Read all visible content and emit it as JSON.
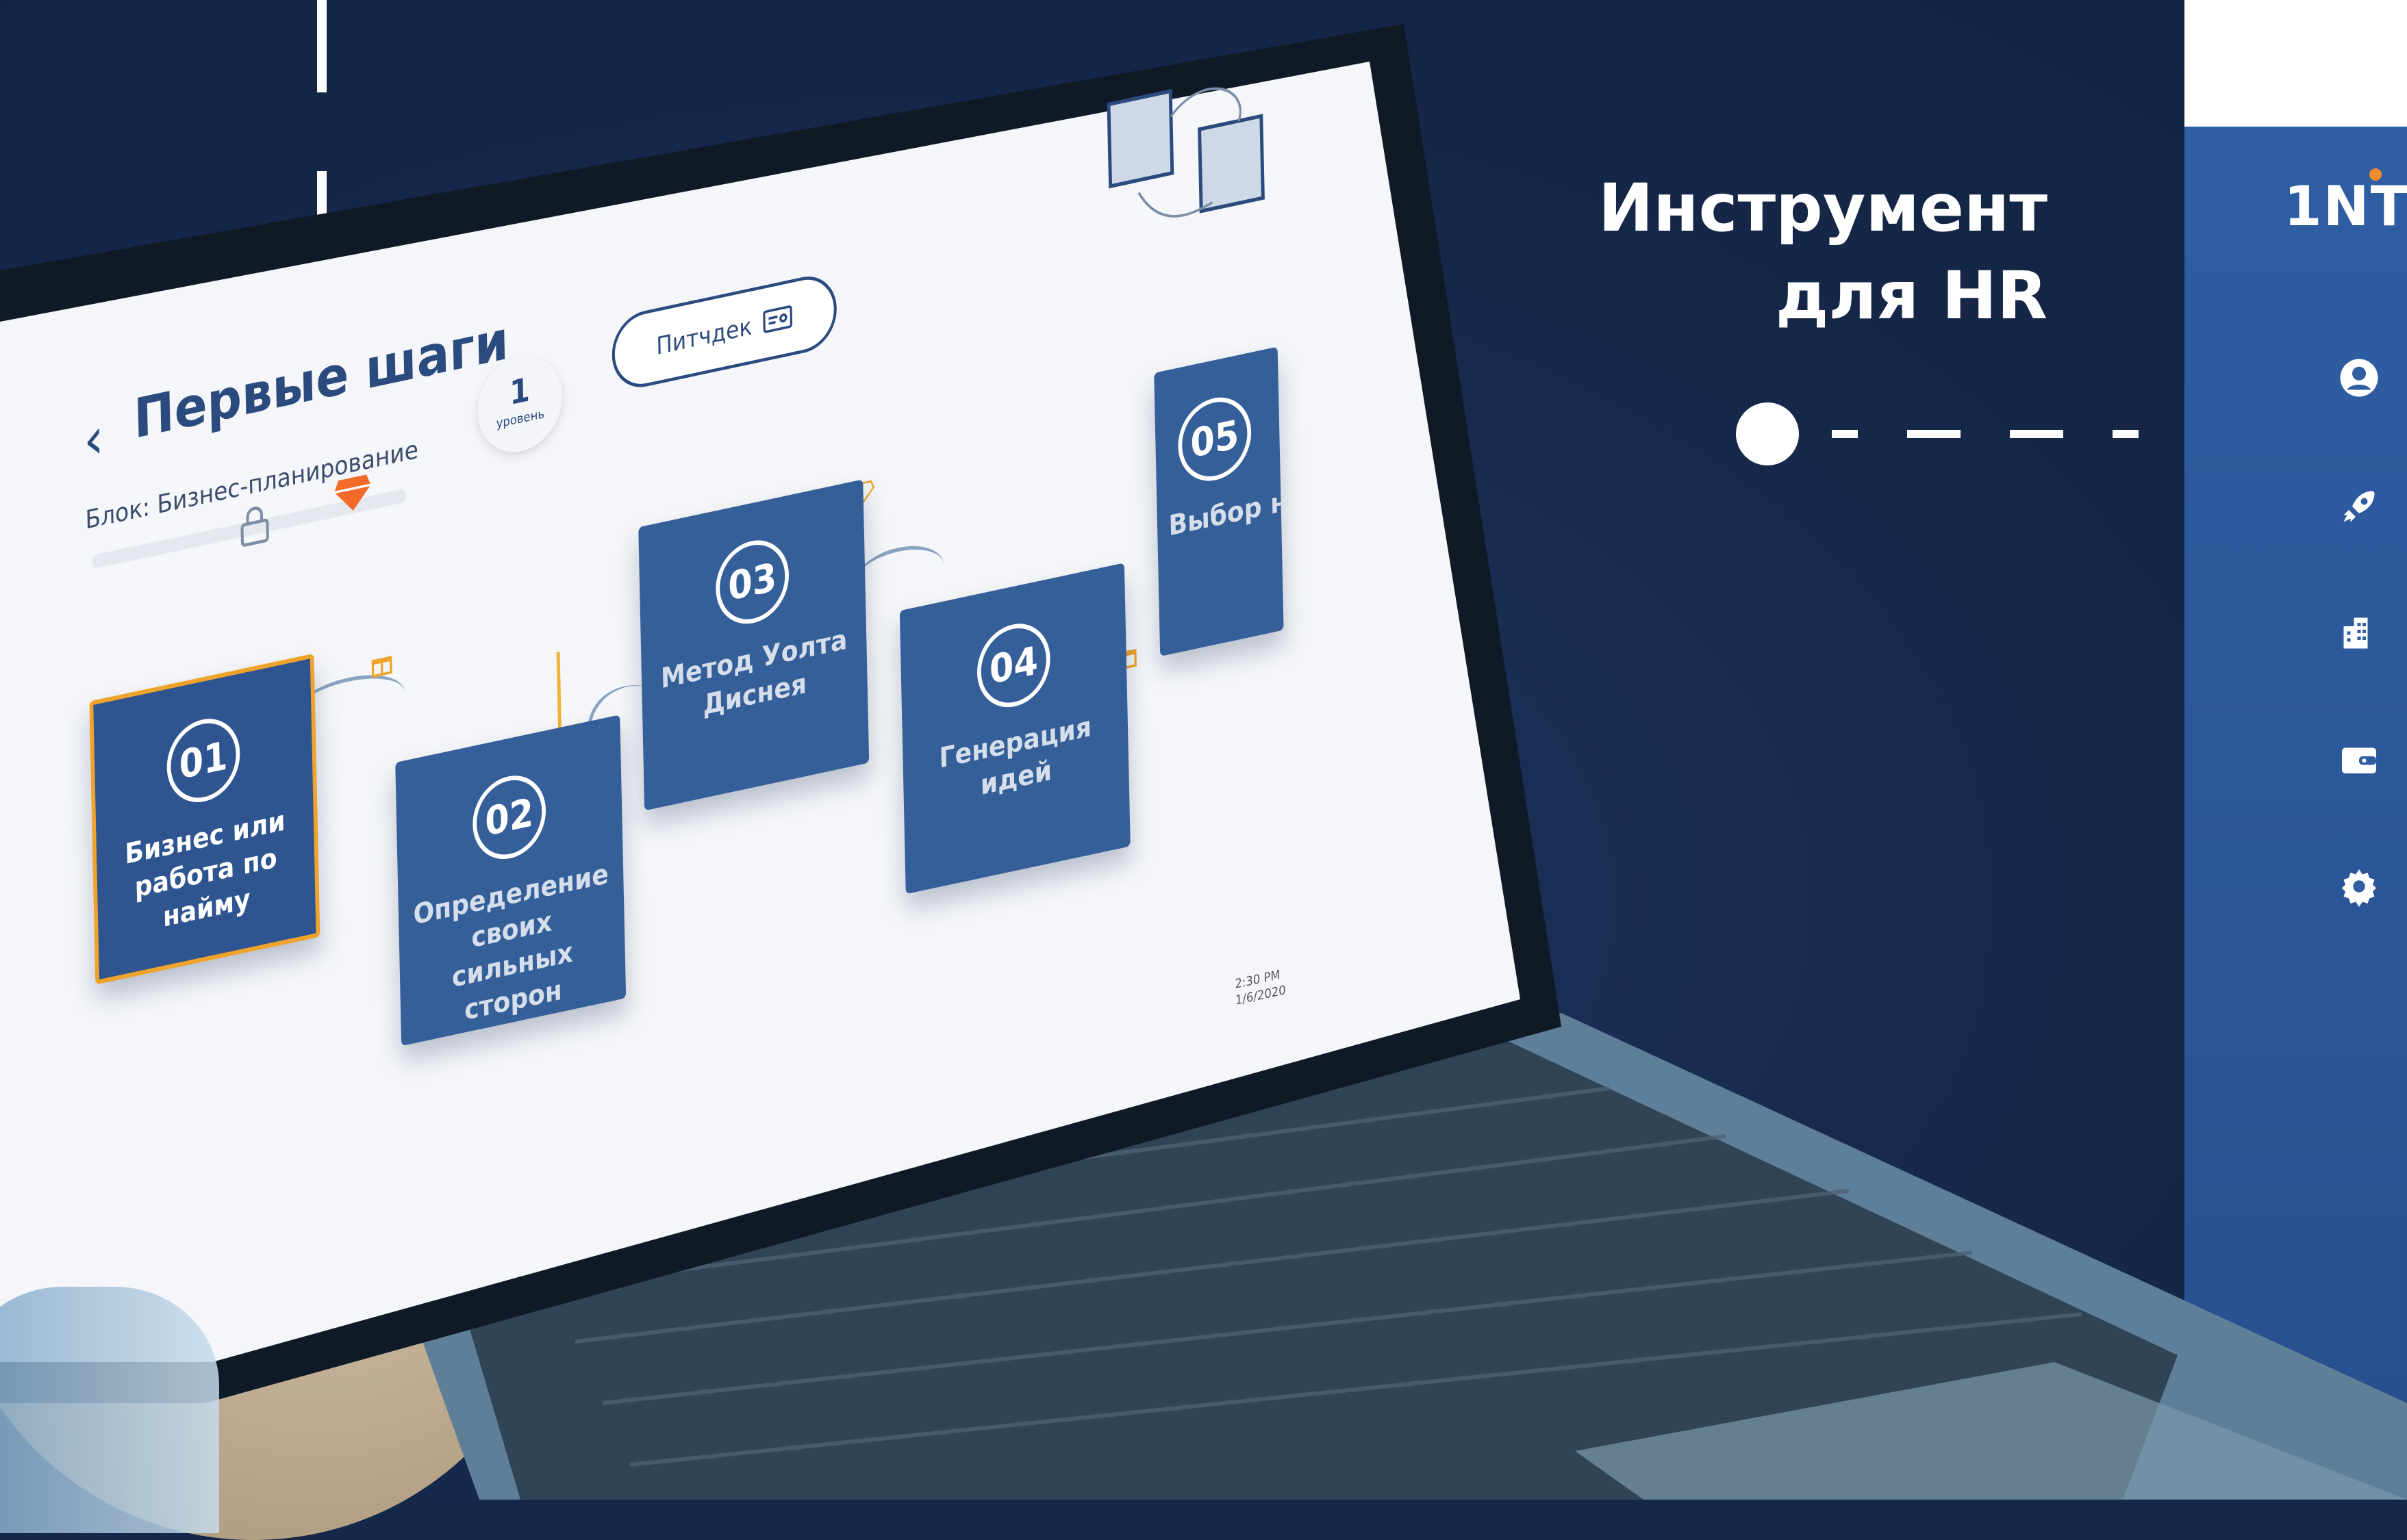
{
  "headline": {
    "line1": "Инструмент",
    "line2": "для HR"
  },
  "brand": {
    "logo_text": "1NT",
    "accent_color": "#f28a2e",
    "panel_color": "#2f5ea3"
  },
  "side_nav": [
    {
      "icon": "user-icon"
    },
    {
      "icon": "rocket-icon"
    },
    {
      "icon": "building-icon"
    },
    {
      "icon": "wallet-icon"
    },
    {
      "icon": "gear-icon"
    }
  ],
  "screen": {
    "back_icon": "chevron-left-icon",
    "title": "Первые шаги",
    "block_label": "Блок: Бизнес-планирование",
    "level": {
      "number": "1",
      "label": "уровень"
    },
    "pitch_button": "Питчдек",
    "cards": [
      {
        "num": "01",
        "label": "Бизнес или работа по найму",
        "active": true
      },
      {
        "num": "02",
        "label": "Определение своих сильных сторон",
        "active": false
      },
      {
        "num": "03",
        "label": "Метод Уолта Диснея",
        "active": false
      },
      {
        "num": "04",
        "label": "Генерация идей",
        "active": false
      },
      {
        "num": "05",
        "label": "Выбор н",
        "active": false
      }
    ],
    "clock": {
      "time": "2:30 PM",
      "date": "1/6/2020"
    }
  },
  "colors": {
    "background": "#16284a",
    "card": "#355f99",
    "card_active_border": "#f0a32a",
    "gem": "#f26b2a"
  }
}
